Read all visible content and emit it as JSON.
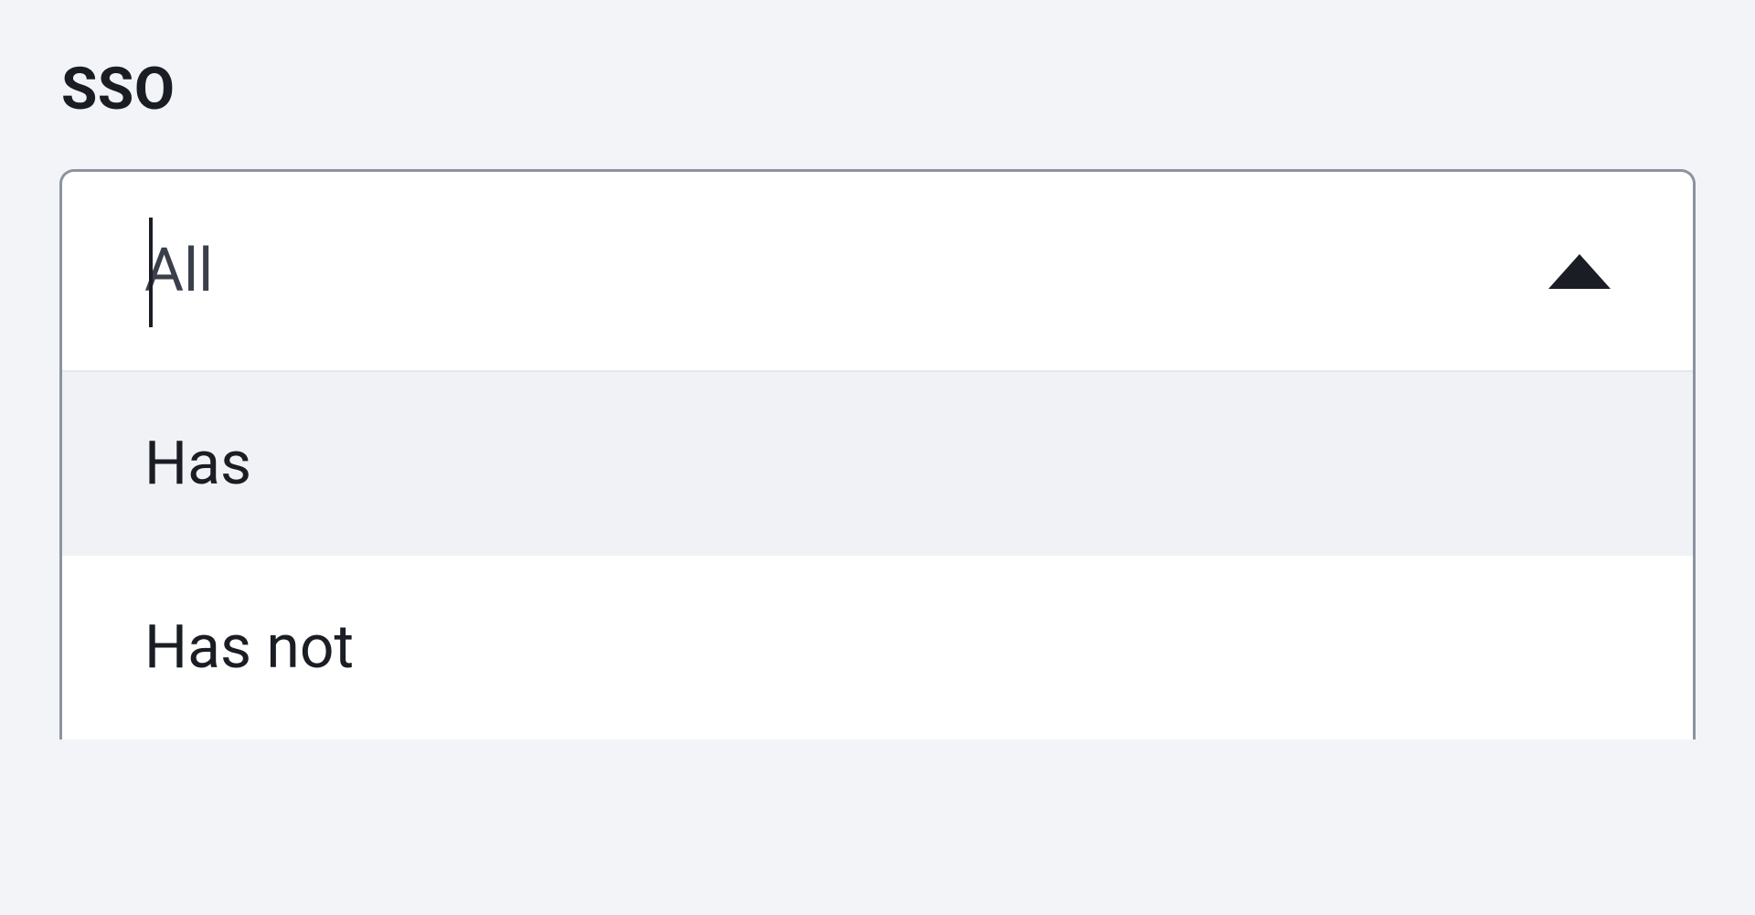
{
  "filter": {
    "label": "SSO",
    "placeholder": "All",
    "options": [
      {
        "label": "Has",
        "highlighted": true
      },
      {
        "label": "Has not",
        "highlighted": false
      }
    ]
  }
}
